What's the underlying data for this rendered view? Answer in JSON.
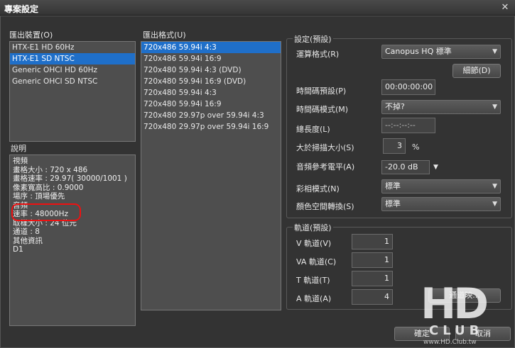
{
  "window": {
    "title": "專案設定",
    "close_glyph": "✕"
  },
  "export_device": {
    "label": "匯出裝置(O)",
    "items": [
      "HTX-E1 HD 60Hz",
      "HTX-E1 SD NTSC",
      "Generic OHCI HD 60Hz",
      "Generic OHCI SD NTSC"
    ],
    "selected_index": 1
  },
  "export_format": {
    "label": "匯出格式(U)",
    "items": [
      "720x486 59.94i 4:3",
      "720x486 59.94i 16:9",
      "720x480 59.94i 4:3 (DVD)",
      "720x480 59.94i 16:9 (DVD)",
      "720x480 59.94i 4:3",
      "720x480 59.94i 16:9",
      "720x480 29.97p over 59.94i 4:3",
      "720x480 29.97p over 59.94i 16:9"
    ],
    "selected_index": 0
  },
  "description": {
    "label": "說明",
    "lines": [
      "視頻",
      "畫格大小 : 720 x 486",
      "畫格速率 : 29.97( 30000/1001 )",
      "像素寬高比 : 0.9000",
      "場序 : 頂場優先",
      "音頻",
      "速率 : 48000Hz",
      "取樣大小 : 24 位元",
      "通道 : 8",
      "其他資訊",
      "D1"
    ]
  },
  "settings": {
    "title": "設定(預設)",
    "codec_label": "運算格式(R)",
    "codec_value": "Canopus HQ 標準",
    "detail_button": "細節(D)",
    "timecode_preset_label": "時間碼預設(P)",
    "timecode_preset_value": "00:00:00:00",
    "timecode_mode_label": "時間碼模式(M)",
    "timecode_mode_value": "不掉?",
    "total_length_label": "總長度(L)",
    "total_length_value": "--:--:--:--",
    "overscan_label": "大於掃描大小(S)",
    "overscan_value": "3",
    "overscan_unit": "%",
    "audio_ref_label": "音頻參考電平(A)",
    "audio_ref_value": "-20.0 dB",
    "color_mode_label": "彩相模式(N)",
    "color_mode_value": "標準",
    "color_space_label": "顏色空間轉換(S)",
    "color_space_value": "標準"
  },
  "tracks": {
    "title": "軌道(預設)",
    "v_label": "V 軌道(V)",
    "v_value": "1",
    "va_label": "VA 軌道(C)",
    "va_value": "1",
    "t_label": "T 軌道(T)",
    "t_value": "1",
    "a_label": "A 軌道(A)",
    "a_value": "4",
    "channel_map_button": "通道映..."
  },
  "footer": {
    "ok_button": "確定",
    "cancel_button": "取消"
  },
  "watermark": {
    "logo": "HD",
    "club": "CLUB",
    "url": "www.HD.Club.tw"
  }
}
